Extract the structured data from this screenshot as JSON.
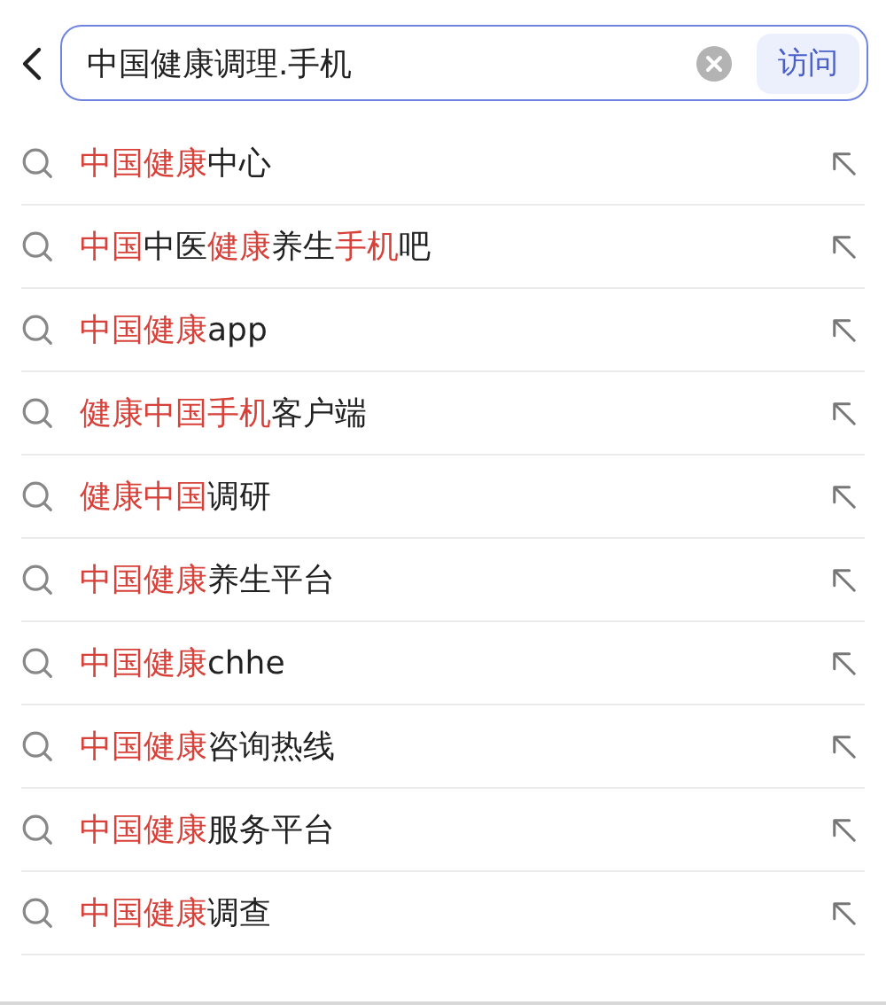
{
  "search": {
    "value": "中国健康调理.手机",
    "button": "访问"
  },
  "suggestions": [
    {
      "parts": [
        {
          "text": "中国健康",
          "highlight": true
        },
        {
          "text": "中心",
          "highlight": false
        }
      ]
    },
    {
      "parts": [
        {
          "text": "中国",
          "highlight": true
        },
        {
          "text": "中医",
          "highlight": false
        },
        {
          "text": "健康",
          "highlight": true
        },
        {
          "text": "养生",
          "highlight": false
        },
        {
          "text": "手机",
          "highlight": true
        },
        {
          "text": "吧",
          "highlight": false
        }
      ]
    },
    {
      "parts": [
        {
          "text": "中国健康",
          "highlight": true
        },
        {
          "text": "app",
          "highlight": false
        }
      ]
    },
    {
      "parts": [
        {
          "text": "健康中国手机",
          "highlight": true
        },
        {
          "text": "客户端",
          "highlight": false
        }
      ]
    },
    {
      "parts": [
        {
          "text": "健康中国",
          "highlight": true
        },
        {
          "text": "调研",
          "highlight": false
        }
      ]
    },
    {
      "parts": [
        {
          "text": "中国健康",
          "highlight": true
        },
        {
          "text": "养生平台",
          "highlight": false
        }
      ]
    },
    {
      "parts": [
        {
          "text": "中国健康",
          "highlight": true
        },
        {
          "text": "chhe",
          "highlight": false
        }
      ]
    },
    {
      "parts": [
        {
          "text": "中国健康",
          "highlight": true
        },
        {
          "text": "咨询热线",
          "highlight": false
        }
      ]
    },
    {
      "parts": [
        {
          "text": "中国健康",
          "highlight": true
        },
        {
          "text": "服务平台",
          "highlight": false
        }
      ]
    },
    {
      "parts": [
        {
          "text": "中国健康",
          "highlight": true
        },
        {
          "text": "调查",
          "highlight": false
        }
      ]
    }
  ]
}
